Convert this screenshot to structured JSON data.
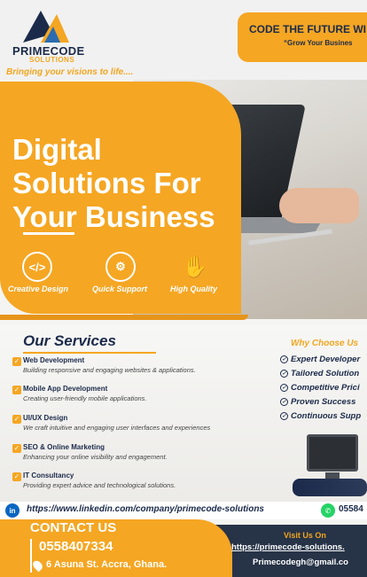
{
  "header": {
    "brand_name": "PRIMECODE",
    "brand_sub": "SOLUTIONS",
    "tagline": "Bringing your visions to life....",
    "banner_title": "CODE THE FUTURE WI",
    "banner_subtitle": "“Grow Your Busines"
  },
  "hero": {
    "title": "Digital Solutions For Your Business",
    "features": [
      {
        "icon": "code-icon",
        "glyph": "</>",
        "label": "Creative Design"
      },
      {
        "icon": "support-icon",
        "glyph": "⚙",
        "label": "Quick Support"
      },
      {
        "icon": "hand-icon",
        "glyph": "✋",
        "label": "High Quality"
      }
    ]
  },
  "services": {
    "title": "Our Services",
    "items": [
      {
        "name": "Web Development",
        "desc": "Building responsive and engaging websites & applications."
      },
      {
        "name": "Mobile App Development",
        "desc": "Creating user-friendly mobile applications."
      },
      {
        "name": "UI/UX Design",
        "desc": "We craft intuitive and engaging user interfaces and experiences"
      },
      {
        "name": "SEO & Online Marketing",
        "desc": "Enhancing your online  visibility and engagement."
      },
      {
        "name": "IT Consultancy",
        "desc": "Providing expert advice and technological solutions."
      }
    ]
  },
  "why": {
    "title": "Why Choose Us",
    "items": [
      "Expert Developer",
      "Tailored Solution",
      "Competitive Prici",
      "Proven Success",
      "Continuous Supp"
    ]
  },
  "social": {
    "linkedin": "https://www.linkedin.com/company/primecode-solutions",
    "whatsapp": "05584"
  },
  "contact": {
    "title": "CONTACT US",
    "phone": "0558407334",
    "address": "6 Asuna St. Accra, Ghana."
  },
  "visit": {
    "title": "Visit Us On",
    "url": "https://primecode-solutions.",
    "email": "Primecodegh@gmail.co"
  },
  "colors": {
    "accent": "#f5a623",
    "navy": "#1b2a4a"
  }
}
